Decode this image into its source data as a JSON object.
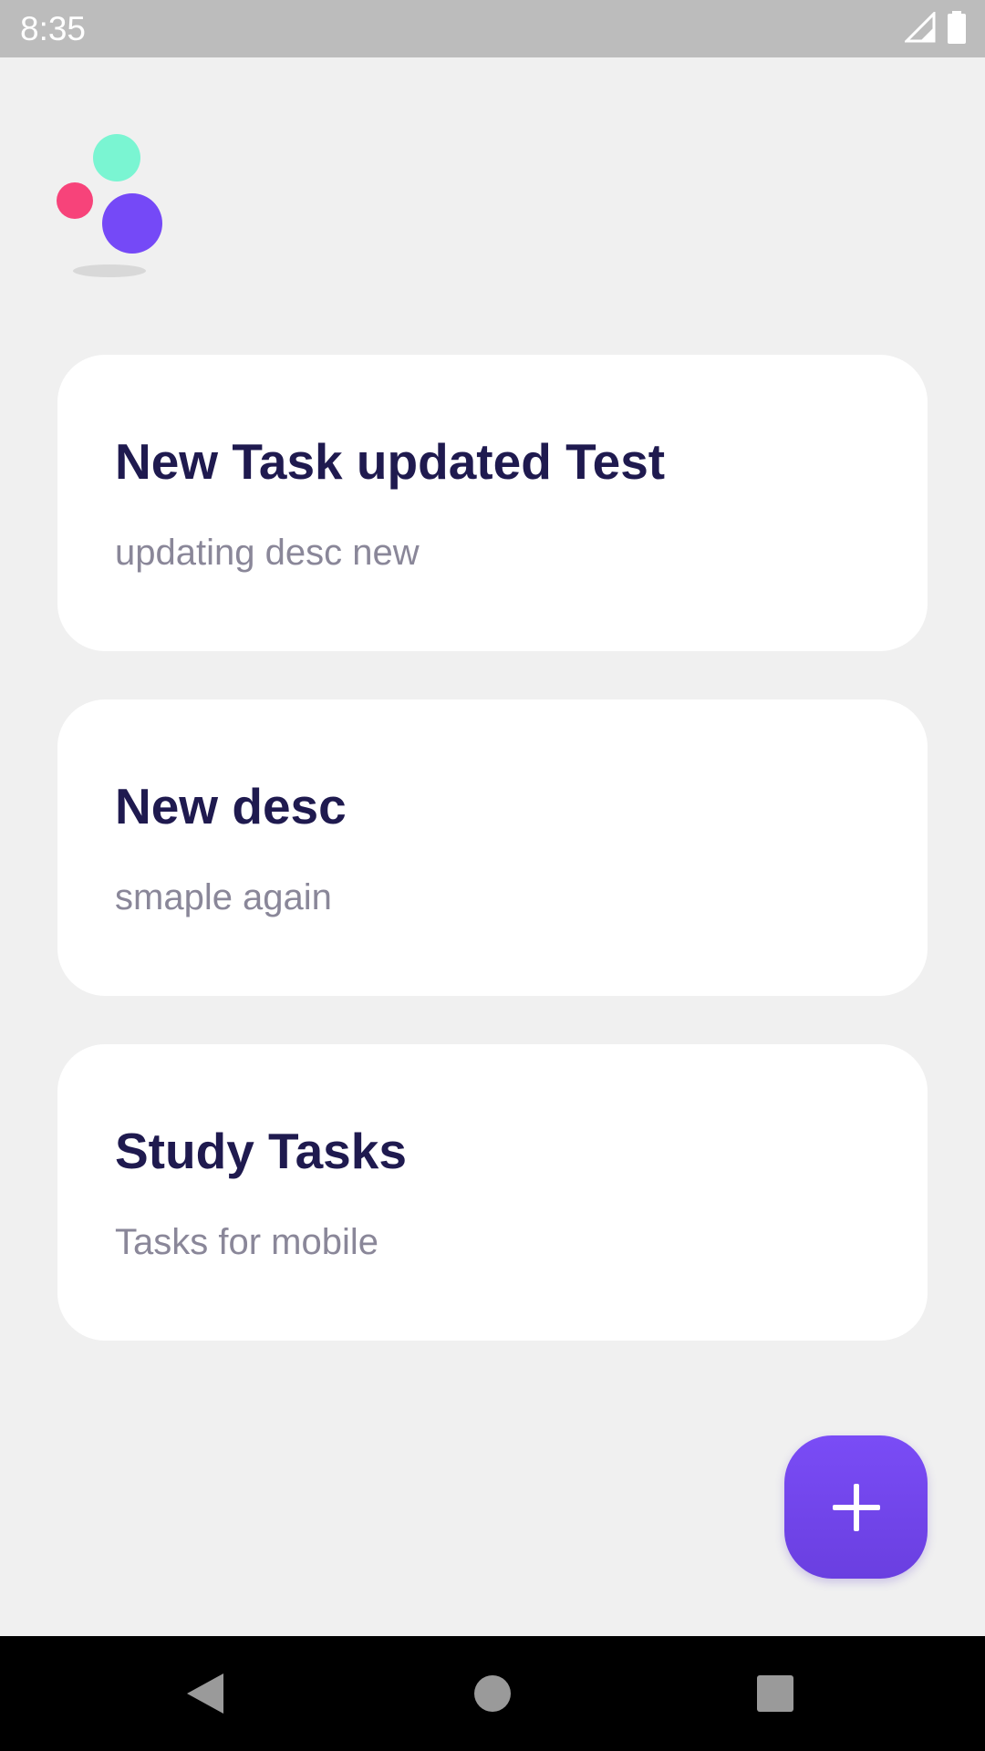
{
  "status_bar": {
    "time": "8:35",
    "icons": [
      "signal-icon",
      "battery-icon"
    ]
  },
  "app": {
    "logo": "bubbles-logo-icon",
    "colors": {
      "background": "#f0f0f0",
      "card": "#ffffff",
      "title": "#1f1a4f",
      "description": "#8a8799",
      "accent": "#7a4cf6",
      "logo_green": "#7af5d2",
      "logo_pink": "#f7437a",
      "logo_purple": "#7549f7"
    }
  },
  "tasks": [
    {
      "title": "New Task updated Test",
      "description": "updating desc new"
    },
    {
      "title": "New desc",
      "description": "smaple again"
    },
    {
      "title": "Study Tasks",
      "description": "Tasks for mobile"
    }
  ],
  "fab": {
    "icon": "plus-icon"
  },
  "navigation": {
    "buttons": [
      "back-icon",
      "home-icon",
      "recents-icon"
    ]
  }
}
